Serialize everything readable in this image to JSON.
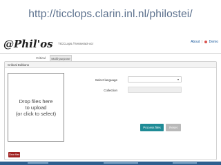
{
  "caption": {
    "url": "http://ticclops.clarin.inl.nl/philostei/"
  },
  "header": {
    "logo_text": "@Phil'osTei",
    "subtitle": "TICCLops // tesseract-ocr",
    "links": {
      "about": "About",
      "separator": "|",
      "demo": "Demo"
    }
  },
  "tabs": [
    {
      "label": "Critical Editions"
    },
    {
      "label": "Multi-purpose"
    }
  ],
  "panel": {
    "heading": "Critical Editions"
  },
  "dropzone": {
    "line1": "Drop files here",
    "line2": "to upload",
    "line3": "(or click to select)"
  },
  "form": {
    "language_label": "Select language",
    "language_value": "",
    "collection_label": "Collection",
    "collection_value": ""
  },
  "buttons": {
    "process": "Process files",
    "reset": "Reset",
    "clear": "Clear files"
  },
  "colors": {
    "process_button": "#1f8b96",
    "clear_button": "#a02323",
    "reset_button": "#b9b9b9",
    "footer_band": "#2e5f8f",
    "caption_text": "#5a6f8c"
  }
}
